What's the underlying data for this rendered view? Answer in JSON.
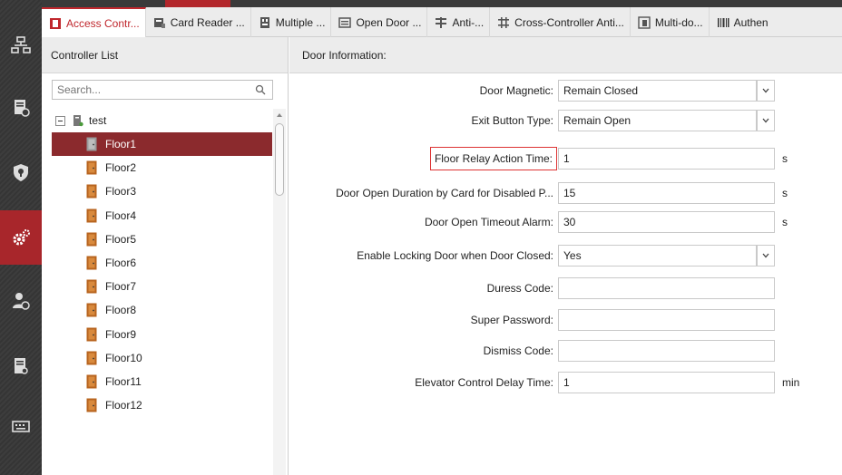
{
  "tabs": [
    {
      "label": "Access Contr...",
      "icon": "door-icon",
      "active": true
    },
    {
      "label": "Card Reader ...",
      "icon": "card-reader-icon"
    },
    {
      "label": "Multiple ...",
      "icon": "multiple-icon"
    },
    {
      "label": "Open Door ...",
      "icon": "open-door-icon"
    },
    {
      "label": "Anti-...",
      "icon": "anti-passback-icon"
    },
    {
      "label": "Cross-Controller Anti...",
      "icon": "cross-controller-icon"
    },
    {
      "label": "Multi-do...",
      "icon": "multi-door-icon"
    },
    {
      "label": "Authen",
      "icon": "barcode-icon"
    }
  ],
  "sidebar": {
    "items": [
      {
        "icon": "network-icon"
      },
      {
        "icon": "clipboard-clock-icon"
      },
      {
        "icon": "shield-icon"
      },
      {
        "icon": "gear-icon",
        "active": true
      },
      {
        "icon": "person-camera-icon"
      },
      {
        "icon": "log-search-icon"
      },
      {
        "icon": "keyboard-icon"
      }
    ]
  },
  "controller_list": {
    "title": "Controller List",
    "search_placeholder": "Search...",
    "root": "test",
    "floors": [
      "Floor1",
      "Floor2",
      "Floor3",
      "Floor4",
      "Floor5",
      "Floor6",
      "Floor7",
      "Floor8",
      "Floor9",
      "Floor10",
      "Floor11",
      "Floor12"
    ],
    "selected": "Floor1"
  },
  "door_info": {
    "title": "Door Information:",
    "fields": [
      {
        "label": "Door Magnetic:",
        "value": "Remain Closed",
        "type": "select"
      },
      {
        "label": "Exit Button Type:",
        "value": "Remain Open",
        "type": "select"
      },
      {
        "label": "Floor Relay Action Time:",
        "value": "1",
        "type": "text",
        "unit": "s",
        "highlighted": true
      },
      {
        "label": "Door Open Duration by Card for Disabled P...",
        "value": "15",
        "type": "text",
        "unit": "s"
      },
      {
        "label": "Door Open Timeout Alarm:",
        "value": "30",
        "type": "text",
        "unit": "s"
      },
      {
        "label": "Enable Locking Door when Door Closed:",
        "value": "Yes",
        "type": "select"
      },
      {
        "label": "Duress Code:",
        "value": "",
        "type": "text"
      },
      {
        "label": "Super Password:",
        "value": "",
        "type": "text"
      },
      {
        "label": "Dismiss Code:",
        "value": "",
        "type": "text"
      },
      {
        "label": "Elevator Control Delay Time:",
        "value": "1",
        "type": "text",
        "unit": "min"
      }
    ]
  },
  "colors": {
    "accent": "#c0272d",
    "selected_row": "#8b2a2d",
    "sidebar": "#3a3a3a"
  }
}
